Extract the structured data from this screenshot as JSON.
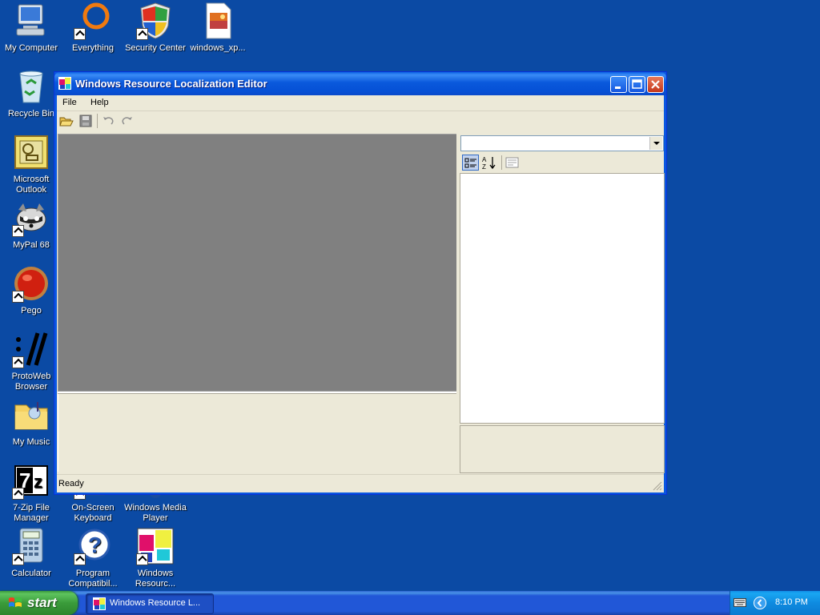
{
  "desktop": {
    "icons": [
      {
        "label": "My Computer"
      },
      {
        "label": "Everything"
      },
      {
        "label": "Security Center"
      },
      {
        "label": "windows_xp..."
      },
      {
        "label": "Recycle Bin"
      },
      {
        "label": "Microsoft Outlook"
      },
      {
        "label": "MyPal 68"
      },
      {
        "label": "Pego"
      },
      {
        "label": "ProtoWeb Browser"
      },
      {
        "label": "My Music"
      },
      {
        "label": "7-Zip File Manager"
      },
      {
        "label": "On-Screen Keyboard"
      },
      {
        "label": "Windows Media Player"
      },
      {
        "label": "Calculator"
      },
      {
        "label": "Program Compatibil..."
      },
      {
        "label": "Windows Resourc..."
      }
    ]
  },
  "window": {
    "title": "Windows Resource Localization Editor",
    "menu": [
      "File",
      "Help"
    ],
    "toolbar": {
      "icons": [
        "open-folder-icon",
        "save-icon",
        "undo-icon",
        "redo-icon"
      ]
    },
    "property_panel": {
      "combo_value": "",
      "tools": [
        "categorized-icon",
        "sort-alphabetical-icon",
        "property-pages-icon"
      ]
    },
    "status": "Ready"
  },
  "taskbar": {
    "start_label": "start",
    "tasks": [
      {
        "label": "Windows Resource L..."
      }
    ],
    "clock": "8:10 PM"
  },
  "colors": {
    "desktop": "#0b4aa4",
    "titlebar": "#0a59dc",
    "window_face": "#ece9d8",
    "canvas": "#808080",
    "start_green": "#3a9b3a",
    "tray_blue": "#0f8be0"
  }
}
